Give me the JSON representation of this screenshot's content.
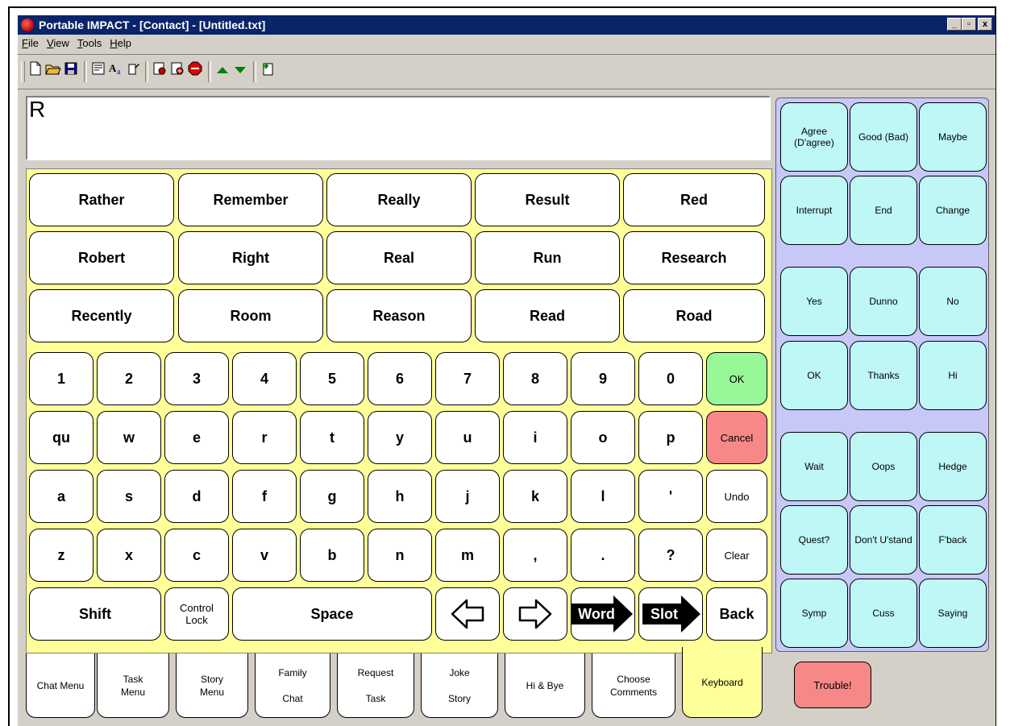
{
  "window": {
    "title": "Portable IMPACT - [Contact] - [Untitled.txt]",
    "minimize_label": "_",
    "maximize_label": "▫",
    "close_label": "x"
  },
  "menu": [
    "File",
    "View",
    "Tools",
    "Help"
  ],
  "toolbar_icons": [
    "new-file-icon",
    "open-folder-icon",
    "save-icon",
    "properties-icon",
    "font-icon",
    "edit-icon",
    "phrase-icon",
    "phrase-add-icon",
    "stop-icon",
    "up-arrow-icon",
    "down-arrow-icon",
    "export-icon"
  ],
  "text_output": "R",
  "word_predictions": [
    [
      "Rather",
      "Remember",
      "Really",
      "Result",
      "Red"
    ],
    [
      "Robert",
      "Right",
      "Real",
      "Run",
      "Research"
    ],
    [
      "Recently",
      "Room",
      "Reason",
      "Read",
      "Road"
    ]
  ],
  "keys": {
    "numbers": [
      "1",
      "2",
      "3",
      "4",
      "5",
      "6",
      "7",
      "8",
      "9",
      "0"
    ],
    "row1": [
      "qu",
      "w",
      "e",
      "r",
      "t",
      "y",
      "u",
      "i",
      "o",
      "p"
    ],
    "row2": [
      "a",
      "s",
      "d",
      "f",
      "g",
      "h",
      "j",
      "k",
      "l",
      "'"
    ],
    "row3": [
      "z",
      "x",
      "c",
      "v",
      "b",
      "n",
      "m",
      ",",
      ".",
      "?"
    ],
    "ok": "OK",
    "cancel": "Cancel",
    "undo": "Undo",
    "clear": "Clear",
    "shift": "Shift",
    "control_lock": "Control Lock",
    "space": "Space",
    "word": "Word",
    "slot": "Slot",
    "back": "Back"
  },
  "side_buttons": [
    [
      "Agree (D'agree)",
      "Good (Bad)",
      "Maybe"
    ],
    [
      "Interrupt",
      "End",
      "Change"
    ],
    [
      "Yes",
      "Dunno",
      "No"
    ],
    [
      "OK",
      "Thanks",
      "Hi"
    ],
    [
      "Wait",
      "Oops",
      "Hedge"
    ],
    [
      "Quest?",
      "Don't U'stand",
      "F'back"
    ],
    [
      "Symp",
      "Cuss",
      "Saying"
    ]
  ],
  "trouble_button": "Trouble!",
  "tabs": [
    {
      "line1": "Chat Menu",
      "line2": ""
    },
    {
      "line1": "Task",
      "line2": "Menu"
    },
    {
      "line1": "Story",
      "line2": "Menu"
    },
    {
      "line1": "Family",
      "line2": "Chat"
    },
    {
      "line1": "Request",
      "line2": "Task"
    },
    {
      "line1": "Joke",
      "line2": "Story"
    },
    {
      "line1": "Hi & Bye",
      "line2": ""
    },
    {
      "line1": "Choose",
      "line2": "Comments"
    },
    {
      "line1": "Keyboard",
      "line2": ""
    }
  ],
  "active_tab": "Keyboard"
}
